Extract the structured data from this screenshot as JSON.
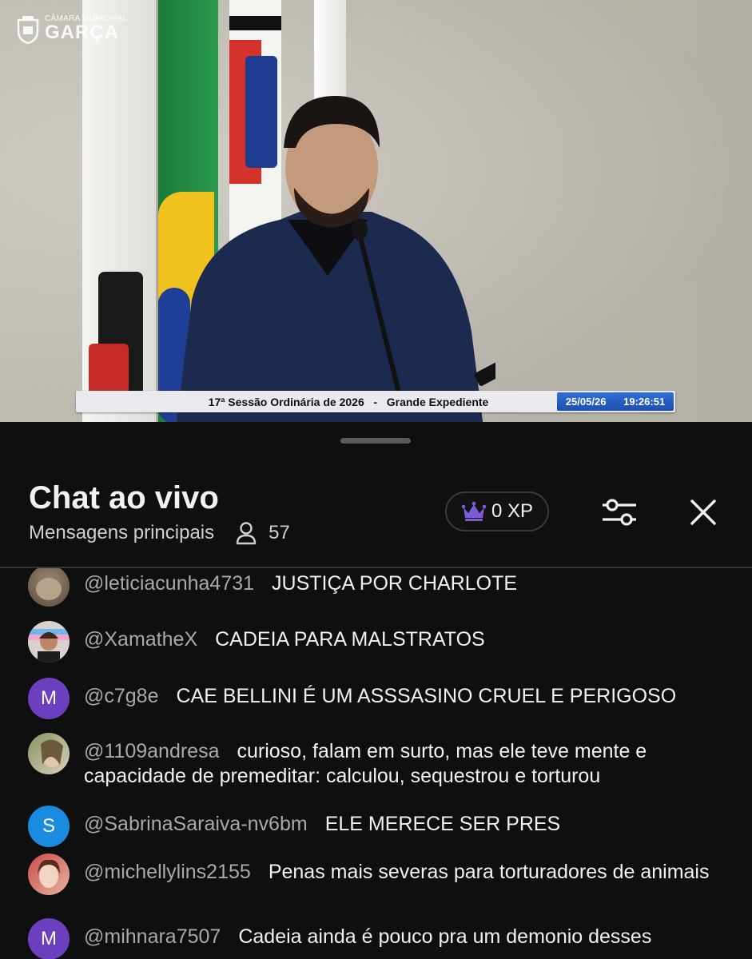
{
  "video": {
    "logo_line1": "CÂMARA MUNICIPAL",
    "logo_line2": "GARÇA",
    "lower_third_title": "17ª Sessão Ordinária de 2026   -   Grande Expediente",
    "lower_third_date": "25/05/26",
    "lower_third_time": "19:26:51"
  },
  "chat": {
    "title": "Chat ao vivo",
    "mode": "Mensagens principais",
    "viewer_count": "57",
    "xp_label": "0 XP",
    "icons": {
      "viewers": "person-icon",
      "xp": "crown-icon",
      "filter": "sliders-icon",
      "close": "close-icon"
    },
    "colors": {
      "background": "#0f0f0f",
      "crown": "#7b5cd6",
      "avatar_purple": "#6b3fbf",
      "avatar_blue": "#1a8ce0"
    }
  },
  "messages": [
    {
      "author": "@leticiacunha4731",
      "text": "JUSTIÇA POR CHARLOTE",
      "avatar_letter": ""
    },
    {
      "author": "@XamatheX",
      "text": "CADEIA PARA MALSTRATOS",
      "avatar_letter": ""
    },
    {
      "author": "@c7g8e",
      "text": "CAE BELLINI É UM ASSSASINO CRUEL E PERIGOSO",
      "avatar_letter": "M"
    },
    {
      "author": "@1109andresa",
      "text": "curioso, falam em surto, mas ele teve mente e capacidade de premeditar: calculou, sequestrou e torturou",
      "avatar_letter": ""
    },
    {
      "author": "@SabrinaSaraiva-nv6bm",
      "text": "ELE MERECE SER PRES",
      "avatar_letter": "S"
    },
    {
      "author": "@michellylins2155",
      "text": "Penas mais severas para torturadores de animais",
      "avatar_letter": ""
    },
    {
      "author": "@mihnara7507",
      "text": "Cadeia ainda é pouco pra um demonio desses",
      "avatar_letter": "M"
    }
  ]
}
